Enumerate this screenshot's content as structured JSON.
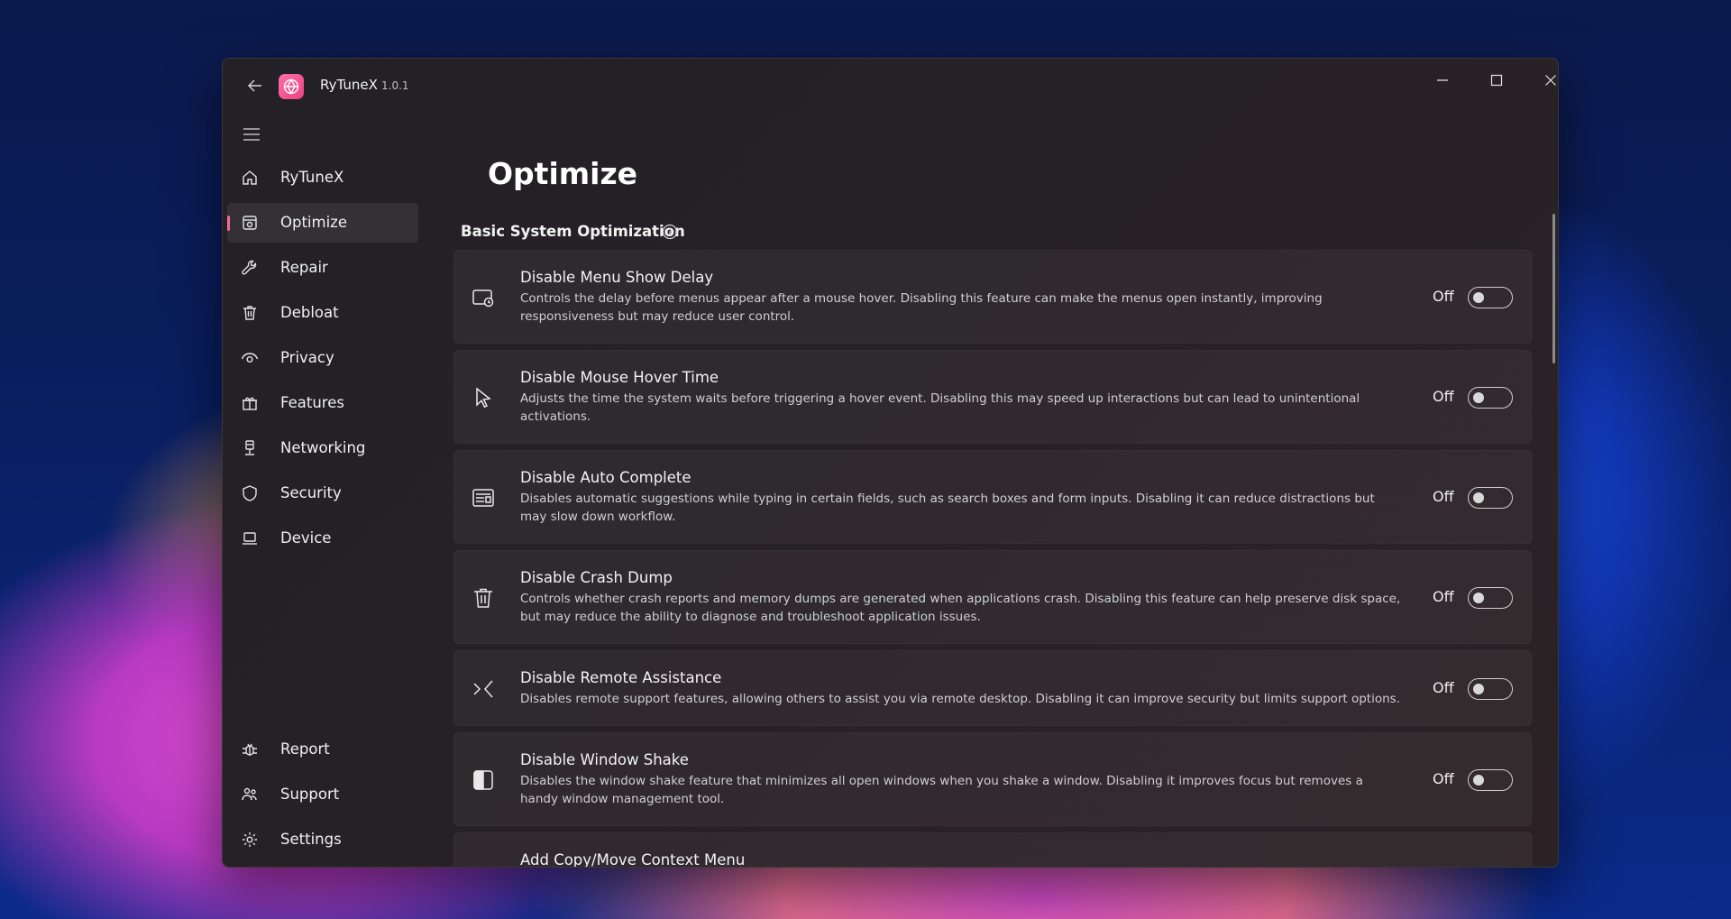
{
  "app": {
    "name": "RyTuneX",
    "version": "1.0.1"
  },
  "nav": {
    "top": [
      {
        "label": "RyTuneX",
        "icon": "home-icon"
      },
      {
        "label": "Optimize",
        "icon": "optimize-icon",
        "active": true
      },
      {
        "label": "Repair",
        "icon": "wrench-icon"
      },
      {
        "label": "Debloat",
        "icon": "trash-icon"
      },
      {
        "label": "Privacy",
        "icon": "eye-icon"
      },
      {
        "label": "Features",
        "icon": "gift-icon"
      },
      {
        "label": "Networking",
        "icon": "ethernet-icon"
      },
      {
        "label": "Security",
        "icon": "shield-icon"
      },
      {
        "label": "Device",
        "icon": "laptop-icon"
      }
    ],
    "bottom": [
      {
        "label": "Report",
        "icon": "bug-icon"
      },
      {
        "label": "Support",
        "icon": "people-icon"
      },
      {
        "label": "Settings",
        "icon": "gear-icon"
      }
    ]
  },
  "page": {
    "title": "Optimize",
    "section": "Basic System Optimization"
  },
  "items": [
    {
      "title": "Disable Menu Show Delay",
      "desc": "Controls the delay before menus appear after a mouse hover. Disabling this feature can make the menus open instantly, improving responsiveness but may reduce user control.",
      "state": "Off",
      "icon": "menu-timer-icon"
    },
    {
      "title": "Disable Mouse Hover Time",
      "desc": "Adjusts the time the system waits before triggering a hover event. Disabling this may speed up interactions but can lead to unintentional activations.",
      "state": "Off",
      "icon": "cursor-icon"
    },
    {
      "title": "Disable Auto Complete",
      "desc": "Disables automatic suggestions while typing in certain fields, such as search boxes and form inputs. Disabling it can reduce distractions but may slow down workflow.",
      "state": "Off",
      "icon": "form-icon"
    },
    {
      "title": "Disable Crash Dump",
      "desc": "Controls whether crash reports and memory dumps are generated when applications crash. Disabling this feature can help preserve disk space, but may reduce the ability to diagnose and troubleshoot application issues.",
      "state": "Off",
      "icon": "trash-icon"
    },
    {
      "title": "Disable Remote Assistance",
      "desc": "Disables remote support features, allowing others to assist you via remote desktop. Disabling it can improve security but limits support options.",
      "state": "Off",
      "icon": "remote-icon"
    },
    {
      "title": "Disable Window Shake",
      "desc": "Disables the window shake feature that minimizes all open windows when you shake a window. Disabling it improves focus but removes a handy window management tool.",
      "state": "Off",
      "icon": "window-split-icon"
    },
    {
      "title": "Add Copy/Move Context Menu",
      "desc": "",
      "state": "",
      "icon": ""
    }
  ]
}
